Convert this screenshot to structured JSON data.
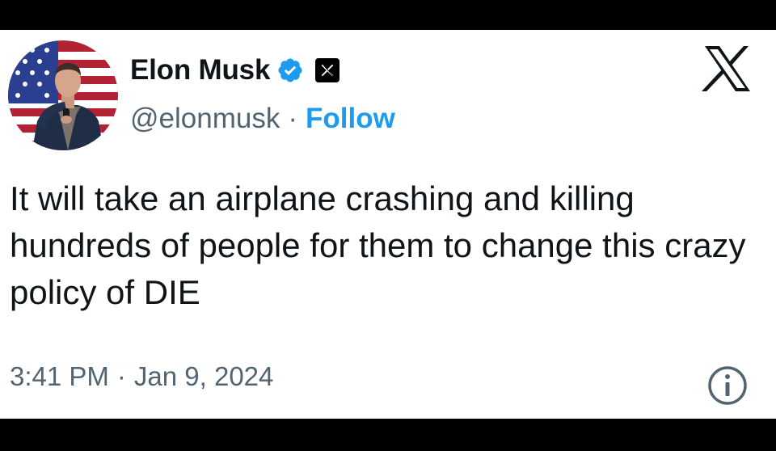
{
  "tweet": {
    "author_name": "Elon Musk",
    "handle": "@elonmusk",
    "separator": "·",
    "follow_label": "Follow",
    "text": "It will take an airplane crashing and killing hundreds of people for them to change this crazy policy of DIE",
    "time": "3:41 PM",
    "date": "Jan 9, 2024"
  },
  "icons": {
    "verified": "verified-badge-icon",
    "affiliation": "x-affiliation-icon",
    "platform": "x-logo-icon",
    "info": "info-icon"
  },
  "colors": {
    "text": "#0f1419",
    "secondary": "#536471",
    "accent_blue": "#1d9bf0"
  }
}
